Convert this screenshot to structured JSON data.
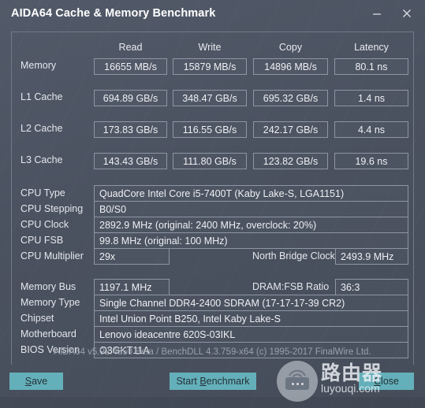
{
  "window": {
    "title": "AIDA64 Cache & Memory Benchmark",
    "minimize_icon": "minimize-icon",
    "close_icon": "close-icon"
  },
  "benchmark": {
    "columns": [
      "Read",
      "Write",
      "Copy",
      "Latency"
    ],
    "rows": [
      {
        "label": "Memory",
        "values": [
          "16655 MB/s",
          "15879 MB/s",
          "14896 MB/s",
          "80.1 ns"
        ]
      },
      {
        "label": "L1 Cache",
        "values": [
          "694.89 GB/s",
          "348.47 GB/s",
          "695.32 GB/s",
          "1.4 ns"
        ]
      },
      {
        "label": "L2 Cache",
        "values": [
          "173.83 GB/s",
          "116.55 GB/s",
          "242.17 GB/s",
          "4.4 ns"
        ]
      },
      {
        "label": "L3 Cache",
        "values": [
          "143.43 GB/s",
          "111.80 GB/s",
          "123.82 GB/s",
          "19.6 ns"
        ]
      }
    ]
  },
  "cpu_info": {
    "cpu_type_label": "CPU Type",
    "cpu_type_value": "QuadCore Intel Core i5-7400T  (Kaby Lake-S, LGA1151)",
    "cpu_stepping_label": "CPU Stepping",
    "cpu_stepping_value": "B0/S0",
    "cpu_clock_label": "CPU Clock",
    "cpu_clock_value": "2892.9 MHz  (original: 2400 MHz, overclock: 20%)",
    "cpu_fsb_label": "CPU FSB",
    "cpu_fsb_value": "99.8 MHz  (original: 100 MHz)",
    "cpu_multiplier_label": "CPU Multiplier",
    "cpu_multiplier_value": "29x",
    "north_bridge_clock_label": "North Bridge Clock",
    "north_bridge_clock_value": "2493.9 MHz"
  },
  "memory_info": {
    "memory_bus_label": "Memory Bus",
    "memory_bus_value": "1197.1 MHz",
    "dram_fsb_ratio_label": "DRAM:FSB Ratio",
    "dram_fsb_ratio_value": "36:3",
    "memory_type_label": "Memory Type",
    "memory_type_value": "Single Channel DDR4-2400 SDRAM  (17-17-17-39 CR2)",
    "chipset_label": "Chipset",
    "chipset_value": "Intel Union Point B250, Intel Kaby Lake-S",
    "motherboard_label": "Motherboard",
    "motherboard_value": "Lenovo ideacentre 620S-03IKL",
    "bios_version_label": "BIOS Version",
    "bios_version_value": "O3GKT11A"
  },
  "footer": {
    "version_text": "AIDA64 v5.92.4350 Beta / BenchDLL 4.3.759-x64  (c) 1995-2017 FinalWire Ltd."
  },
  "buttons": {
    "save": "Save",
    "save_accel": "S",
    "save_rest": "ave",
    "start_pre": "Start ",
    "start_accel": "B",
    "start_rest": "enchmark",
    "close_pre": "",
    "close_accel": "C",
    "close_rest": "lose",
    "accent_color": "#64b0ba"
  },
  "watermark": {
    "cn_text": "路由器",
    "en_text": "luyouqi.com",
    "icon": "router-icon"
  },
  "colors": {
    "window_bg": "#4a515f",
    "border": "#8e96a3",
    "text": "#e8eaee",
    "muted_text": "#99a1ad"
  }
}
